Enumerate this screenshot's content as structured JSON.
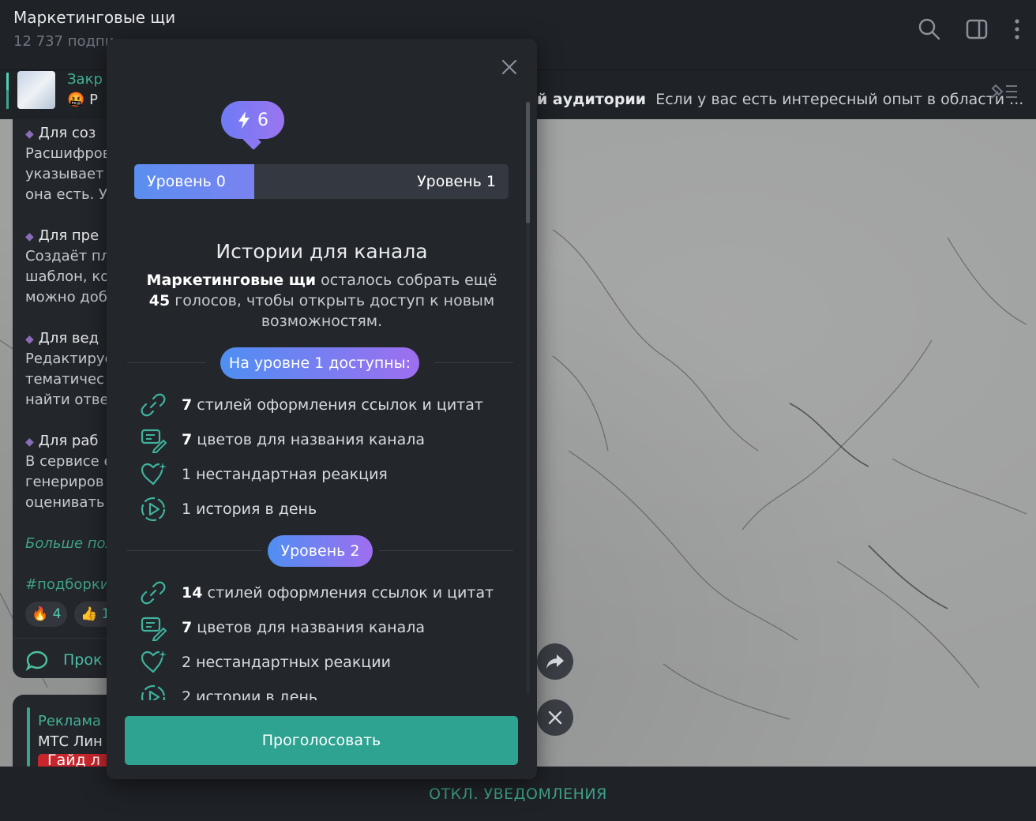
{
  "channel": {
    "title": "Маркетинговые щи",
    "subscribers": "12 737 подпи"
  },
  "pinned": {
    "title_fragment": "Закр",
    "text_fragment": "Р",
    "bold": "й аудитории",
    "text": "Если у вас есть интересный опыт в области ..."
  },
  "message": {
    "lines": [
      {
        "text": "Для соз",
        "type": "head"
      },
      {
        "text": "Расшифров",
        "type": "body"
      },
      {
        "text": "указывает",
        "type": "body"
      },
      {
        "text": "она есть. У",
        "type": "body"
      },
      {
        "text": "Для пре",
        "type": "head"
      },
      {
        "text": "Создаёт пл",
        "type": "body"
      },
      {
        "text": "шаблон, ко",
        "type": "body"
      },
      {
        "text": "можно доб",
        "type": "body"
      },
      {
        "text": "Для вед",
        "type": "head"
      },
      {
        "text": "Редактируе",
        "type": "body"
      },
      {
        "text": "тематичес",
        "type": "body"
      },
      {
        "text": "найти отве",
        "type": "body"
      },
      {
        "text": "Для раб",
        "type": "head"
      },
      {
        "text": "В сервисе е",
        "type": "body"
      },
      {
        "text": "генериров",
        "type": "body"
      },
      {
        "text": "оценивать",
        "type": "body"
      }
    ],
    "more_link": "Больше пол",
    "hashtag": "#подборки",
    "reactions": [
      {
        "emoji": "🔥",
        "count": "4"
      },
      {
        "emoji": "👍",
        "count": "1"
      }
    ],
    "comment_label": "Прок"
  },
  "ad": {
    "label": "Реклама",
    "sponsor": "МТС Лин",
    "tag": "Гайд л"
  },
  "bottom": {
    "label": "ОТКЛ. УВЕДОМЛЕНИЯ"
  },
  "modal": {
    "boost_count": "6",
    "level_current": "Уровень 0",
    "level_next": "Уровень 1",
    "progress_fraction": 0.32,
    "title": "Истории для канала",
    "desc_channel": "Маркетинговые щи",
    "desc_part1": " осталось собрать ещё ",
    "desc_votes": "45",
    "desc_part2": " голосов, чтобы открыть доступ к новым возможностям.",
    "level1_pill": "На уровне 1 доступны:",
    "level1_features": [
      {
        "num": "7",
        "text": " стилей оформления ссылок и цитат",
        "icon": "link-icon"
      },
      {
        "num": "7",
        "text": " цветов для названия канала",
        "icon": "palette-icon"
      },
      {
        "num": "",
        "text": "1 нестандартная реакция",
        "icon": "heart-sparkle-icon"
      },
      {
        "num": "",
        "text": "1 история в день",
        "icon": "story-play-icon"
      }
    ],
    "level2_pill": "Уровень 2",
    "level2_features": [
      {
        "num": "14",
        "text": " стилей оформления ссылок и цитат",
        "icon": "link-icon"
      },
      {
        "num": "7",
        "text": " цветов для названия канала",
        "icon": "palette-icon"
      },
      {
        "num": "",
        "text": "2 нестандартных реакции",
        "icon": "heart-sparkle-icon"
      },
      {
        "num": "",
        "text": "2 истории в день",
        "icon": "story-play-icon"
      }
    ],
    "vote_button": "Проголосовать"
  },
  "colors": {
    "accent": "#2ea391",
    "gradient_start": "#4f8ff2",
    "gradient_end": "#9e6ef0"
  }
}
